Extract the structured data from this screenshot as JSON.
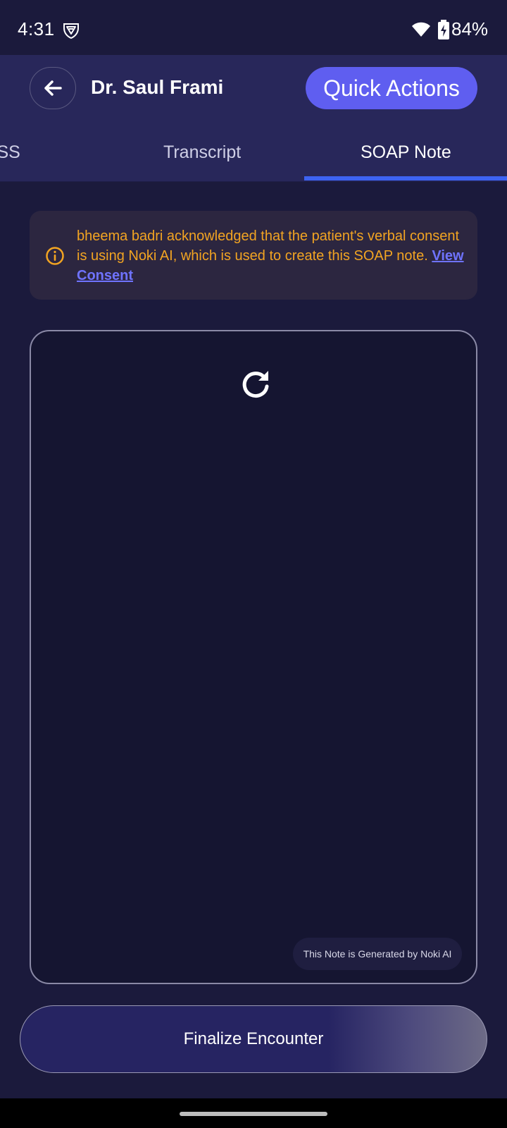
{
  "status_bar": {
    "time": "4:31",
    "battery_text": "84%",
    "icons": [
      "vpn-shield-icon",
      "wifi-icon",
      "battery-charging-icon"
    ]
  },
  "header": {
    "back_icon": "arrow-left-icon",
    "doctor_name": "Dr. Saul Frami",
    "quick_actions_label": "Quick Actions"
  },
  "tabs": {
    "items": [
      {
        "label": "OSS",
        "active": false
      },
      {
        "label": "Transcript",
        "active": false
      },
      {
        "label": "SOAP Note",
        "active": true
      }
    ]
  },
  "consent": {
    "icon": "info-circle-icon",
    "text": "bheema badri acknowledged that the patient's verbal consent is using Noki AI, which is used to create this SOAP note.",
    "link_label": "View Consent"
  },
  "note_panel": {
    "refresh_icon": "refresh-icon",
    "ai_badge_text": "This Note is Generated by Noki AI"
  },
  "footer": {
    "finalize_label": "Finalize Encounter"
  },
  "colors": {
    "background": "#1b1a3c",
    "header": "#28275a",
    "accent": "#5f5ef0",
    "tab_indicator": "#3d63f2",
    "consent_text": "#f2a422",
    "link": "#6f73ff"
  }
}
